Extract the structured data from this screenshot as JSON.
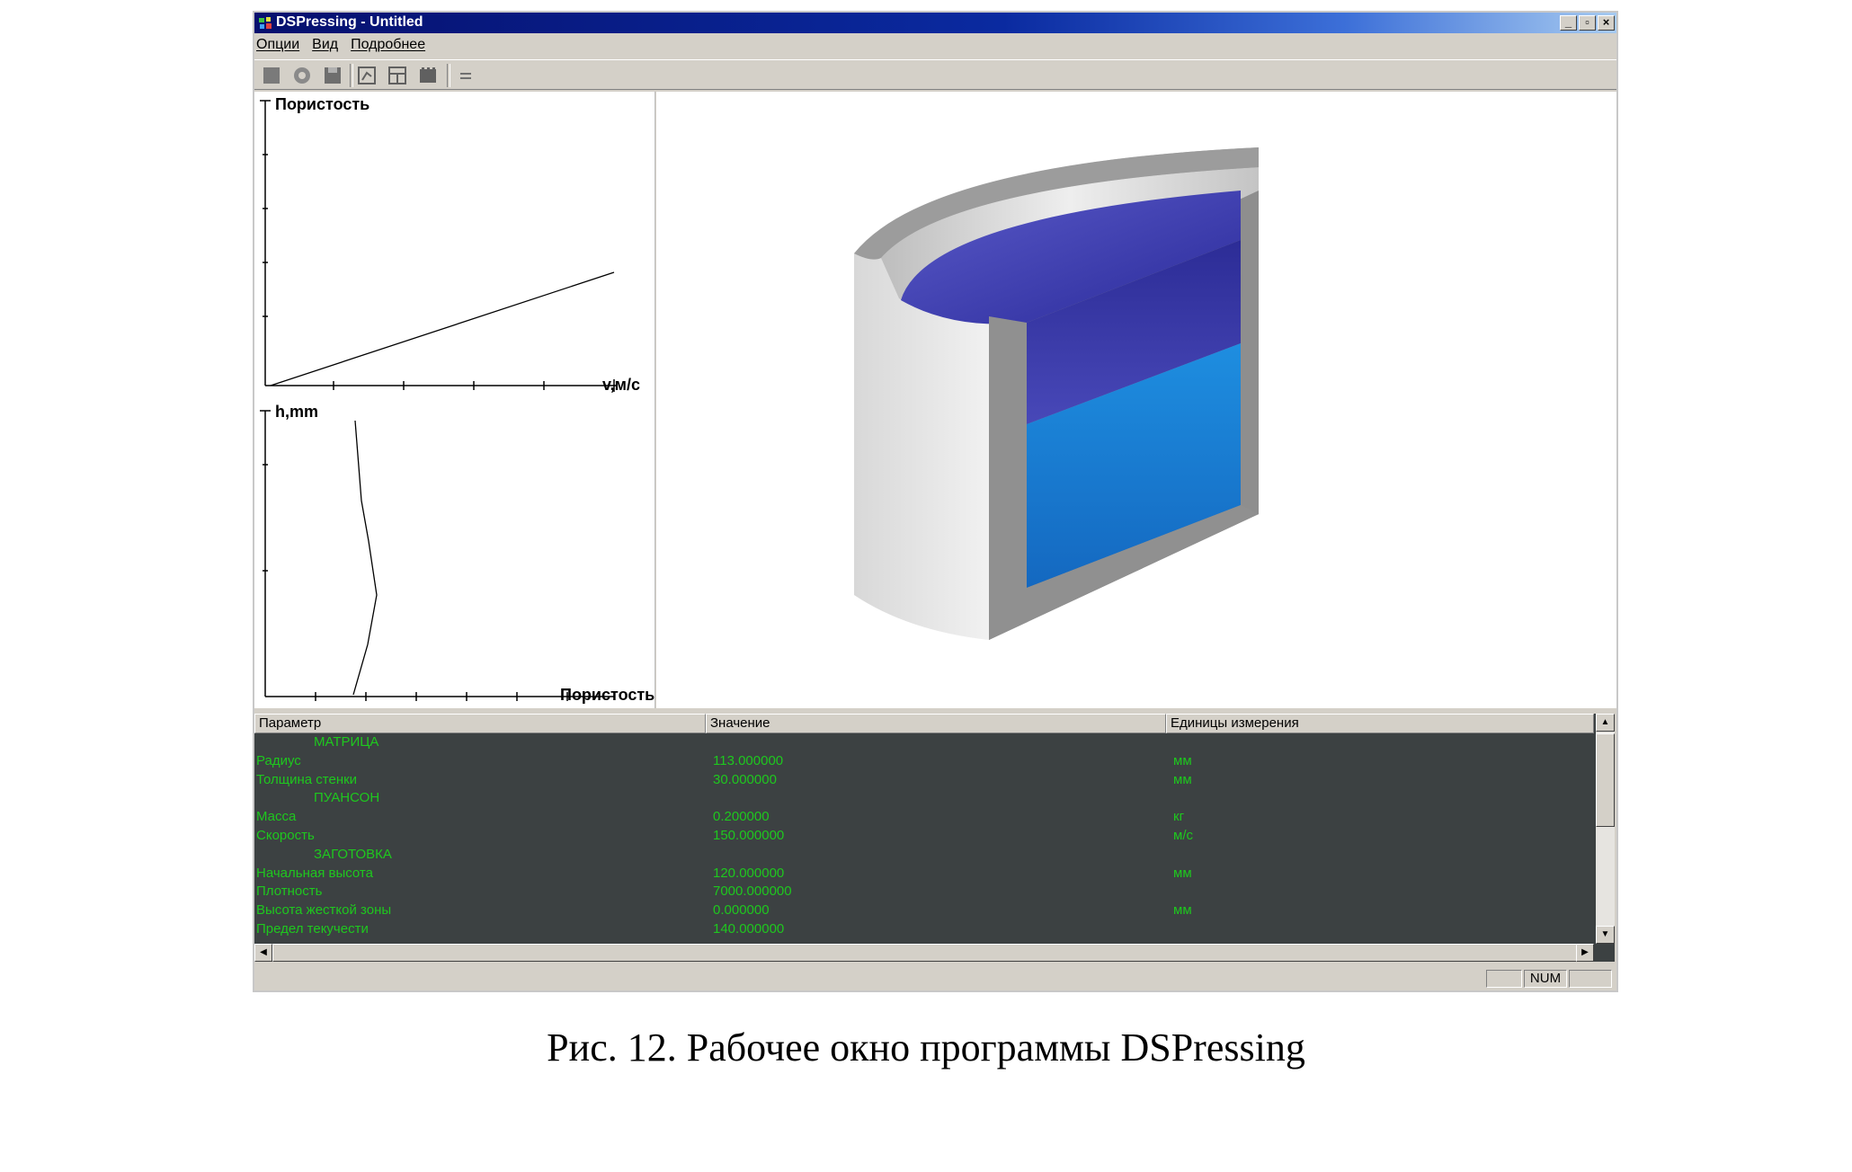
{
  "window": {
    "title": "DSPressing - Untitled"
  },
  "window_buttons": {
    "minimize": "_",
    "restore": "▫",
    "close": "×"
  },
  "menu": [
    "Опции",
    "Вид",
    "Подробнее"
  ],
  "graphs": {
    "top": {
      "ylabel": "Пористость",
      "xlabel": "v,м/с"
    },
    "bottom": {
      "ylabel": "h,mm",
      "xlabel": "Пористость"
    }
  },
  "table": {
    "columns": [
      "Параметр",
      "Значение",
      "Единицы измерения"
    ],
    "rows": [
      {
        "param": "МАТРИЦА",
        "value": "",
        "unit": "",
        "section": true
      },
      {
        "param": "Радиус",
        "value": "113.000000",
        "unit": "мм"
      },
      {
        "param": "Толщина стенки",
        "value": "30.000000",
        "unit": "мм"
      },
      {
        "param": "ПУАНСОН",
        "value": "",
        "unit": "",
        "section": true
      },
      {
        "param": "Масса",
        "value": "0.200000",
        "unit": "кг"
      },
      {
        "param": "Скорость",
        "value": "150.000000",
        "unit": "м/с"
      },
      {
        "param": "ЗАГОТОВКА",
        "value": "",
        "unit": "",
        "section": true
      },
      {
        "param": "Начальная высота",
        "value": "120.000000",
        "unit": "мм"
      },
      {
        "param": "Плотность",
        "value": "7000.000000",
        "unit": ""
      },
      {
        "param": "Высота жесткой зоны",
        "value": "0.000000",
        "unit": "мм"
      },
      {
        "param": "Предел текучести",
        "value": "140.000000",
        "unit": ""
      }
    ]
  },
  "status": {
    "num": "NUM"
  },
  "caption": "Рис. 12. Рабочее окно программы DSPressing",
  "colors": {
    "titlebar": "#0a2aa0",
    "table_bg": "#3c4142",
    "table_text": "#1ec81e",
    "billet_upper": "#3a3ab0",
    "billet_lower": "#1a78d0"
  }
}
